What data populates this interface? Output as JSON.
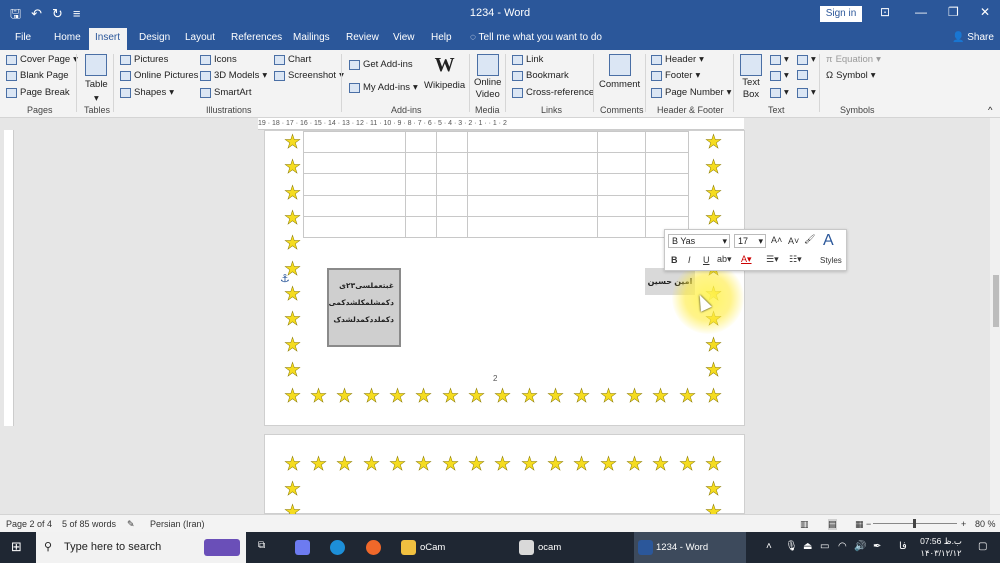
{
  "title_bar": {
    "doc_title": "1234  -  Word",
    "sign_in": "Sign in"
  },
  "tabs": [
    "File",
    "Home",
    "Insert",
    "Design",
    "Layout",
    "References",
    "Mailings",
    "Review",
    "View",
    "Help"
  ],
  "tell_me": "Tell me what you want to do",
  "share": "Share",
  "ribbon": {
    "pages": {
      "cover_page": "Cover Page",
      "blank_page": "Blank Page",
      "page_break": "Page Break",
      "group": "Pages"
    },
    "tables": {
      "table": "Table",
      "group": "Tables"
    },
    "illustrations": {
      "pictures": "Pictures",
      "online_pictures": "Online Pictures",
      "shapes": "Shapes",
      "icons": "Icons",
      "models_3d": "3D Models",
      "smartart": "SmartArt",
      "chart": "Chart",
      "screenshot": "Screenshot",
      "group": "Illustrations"
    },
    "addins": {
      "get_addins": "Get Add-ins",
      "my_addins": "My Add-ins",
      "wikipedia": "Wikipedia",
      "group": "Add-ins"
    },
    "media": {
      "online_video_1": "Online",
      "online_video_2": "Video",
      "group": "Media"
    },
    "links": {
      "link": "Link",
      "bookmark": "Bookmark",
      "cross_reference": "Cross-reference",
      "group": "Links"
    },
    "comments": {
      "comment": "Comment",
      "group": "Comments"
    },
    "header_footer": {
      "header": "Header",
      "footer": "Footer",
      "page_number": "Page Number",
      "group": "Header & Footer"
    },
    "text": {
      "text_box_1": "Text",
      "text_box_2": "Box",
      "group": "Text"
    },
    "symbols": {
      "equation": "Equation",
      "symbol": "Symbol",
      "group": "Symbols"
    }
  },
  "ruler_text": "19 · 18 · 17 · 16 · 15 · 14 · 13 · 12 · 11 · 10 · 9 · 8 · 7 · 6 · 5 · 4 · 3 · 2 · 1 ·   · 1 · 2",
  "document": {
    "textbox_lines": [
      "غبتعملسی۲۳ی",
      "دکمشلمکلشدکمی",
      "دکملددکمدلشدک"
    ],
    "name_text": "امین حسین",
    "page_number": "2"
  },
  "mini_toolbar": {
    "font_name": "B Yas",
    "font_size": "17",
    "styles": "Styles"
  },
  "status_bar": {
    "page": "Page 2 of 4",
    "words": "5 of 85 words",
    "language": "Persian (Iran)",
    "zoom": "80 %"
  },
  "taskbar": {
    "search_placeholder": "Type here to search",
    "apps": [
      "oCam",
      "ocam",
      "1234 - Word"
    ],
    "lang": "فا",
    "time": "07:56 ب.ظ",
    "date": "۱۴۰۳/۱۲/۱۲"
  },
  "colors": {
    "word_blue": "#2b579a",
    "star": "#f5dc20"
  }
}
